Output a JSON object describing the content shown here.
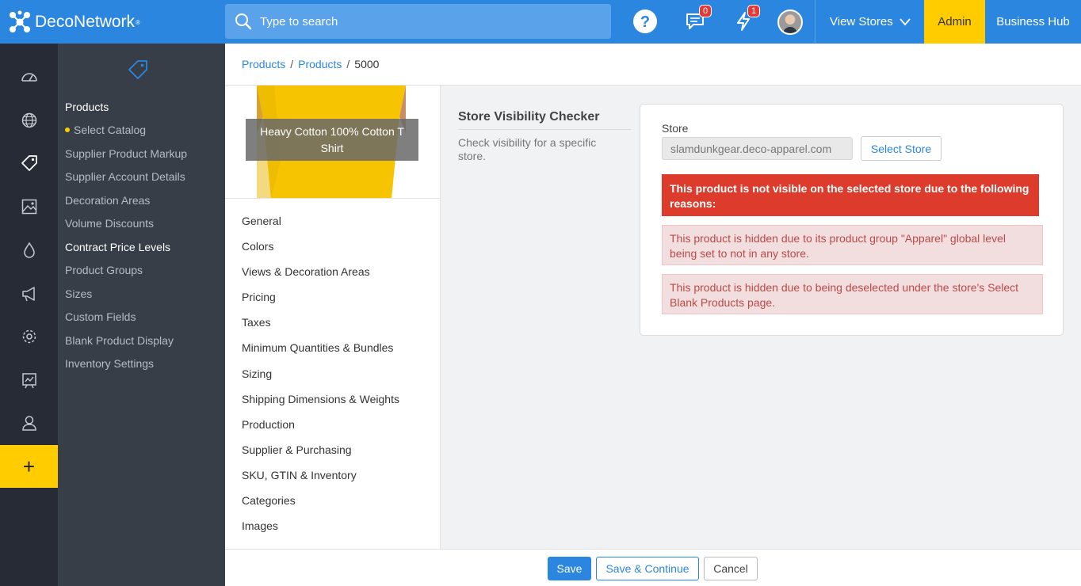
{
  "header": {
    "brand": "DecoNetwork",
    "brand_mark": "®",
    "search_placeholder": "Type to search",
    "messages_count": "0",
    "alerts_count": "1",
    "view_stores": "View Stores",
    "admin": "Admin",
    "business_hub": "Business Hub",
    "colors": {
      "bar": "#2b86e0",
      "admin": "#ffcc00"
    }
  },
  "rail": {
    "icons": [
      "dashboard-icon",
      "globe-icon",
      "tag-icon",
      "image-icon",
      "drop-icon",
      "megaphone-icon",
      "gear-icon",
      "chart-icon",
      "user-icon"
    ],
    "add": "+"
  },
  "subnav": {
    "title": "Products",
    "items": [
      {
        "label": "Select Catalog",
        "active": false,
        "dot": true
      },
      {
        "label": "Supplier Product Markup"
      },
      {
        "label": "Supplier Account Details"
      },
      {
        "label": "Decoration Areas"
      },
      {
        "label": "Volume Discounts"
      },
      {
        "label": "Contract Price Levels",
        "active": true
      },
      {
        "label": "Product Groups"
      },
      {
        "label": "Sizes"
      },
      {
        "label": "Custom Fields"
      },
      {
        "label": "Blank Product Display"
      },
      {
        "label": "Inventory Settings"
      }
    ]
  },
  "breadcrumb": {
    "first": "Products",
    "second": "Products",
    "current": "5000"
  },
  "product": {
    "name": "Heavy Cotton 100% Cotton T Shirt",
    "menu": [
      "General",
      "Colors",
      "Views & Decoration Areas",
      "Pricing",
      "Taxes",
      "Minimum Quantities & Bundles",
      "Sizing",
      "Shipping Dimensions & Weights",
      "Production",
      "Supplier & Purchasing",
      "SKU, GTIN & Inventory",
      "Categories",
      "Images"
    ]
  },
  "checker": {
    "title": "Store Visibility Checker",
    "description": "Check visibility for a specific store.",
    "store_label": "Store",
    "store_value": "slamdunkgear.deco-apparel.com",
    "select_store": "Select Store",
    "alert_main": "This product is not visible on the selected store due to the following reasons:",
    "reasons": [
      "This product is hidden due to its product group \"Apparel\" global level being set to not in any store.",
      "This product is hidden due to being deselected under the store's Select Blank Products page."
    ]
  },
  "footer": {
    "save": "Save",
    "save_continue": "Save & Continue",
    "cancel": "Cancel"
  }
}
